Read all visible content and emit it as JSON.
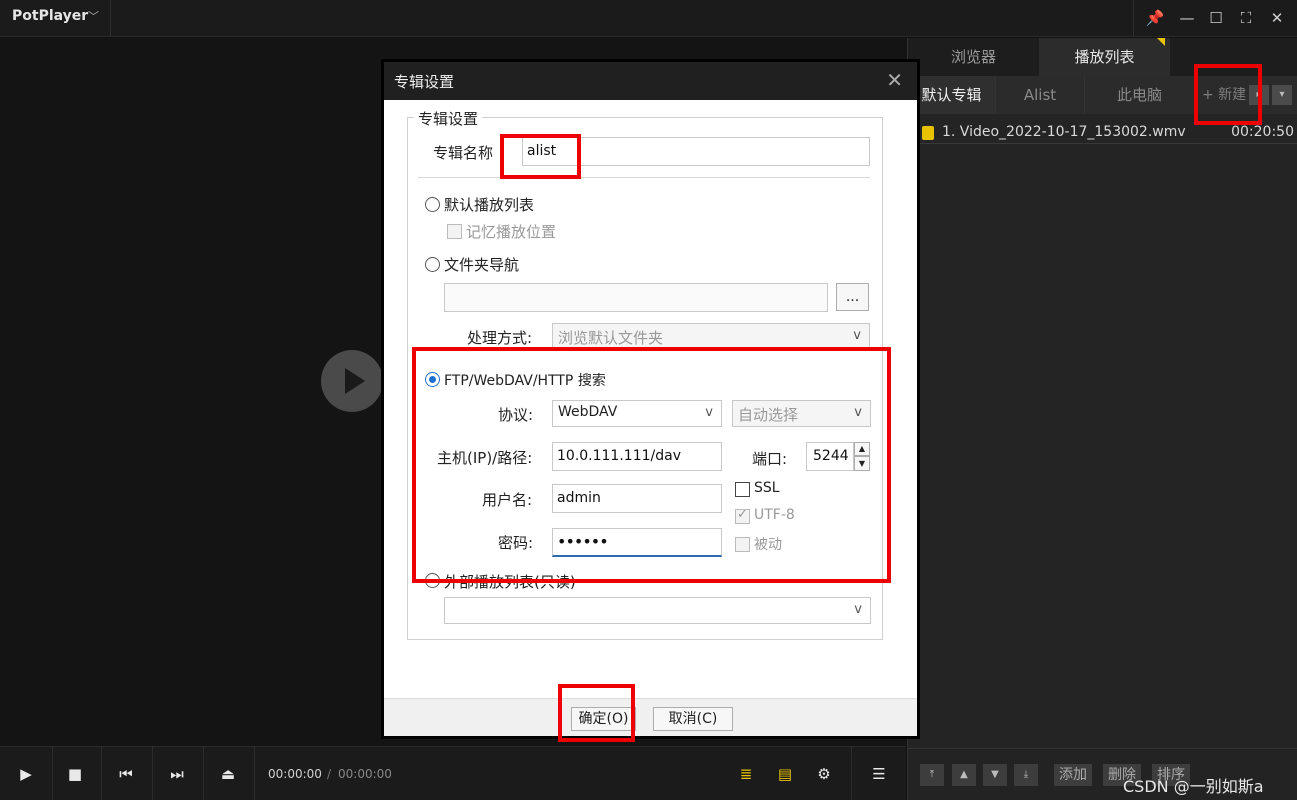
{
  "app": {
    "title": "PotPlayer",
    "title_chevron": "﹀"
  },
  "window_buttons": {
    "pin": "📌",
    "minimize": "—",
    "maximize": "☐",
    "fullscreen": "⛶",
    "close": "✕"
  },
  "controls": {
    "play": "▶",
    "stop": "■",
    "prev": "⏮",
    "next": "⏭",
    "eject": "⏏",
    "time_current": "00:00:00",
    "time_separator": "/",
    "time_total": "00:00:00",
    "playlist_search": "≣",
    "subtitle": "▤",
    "settings": "⚙",
    "menu": "☰"
  },
  "panel": {
    "tabs": [
      {
        "label": "浏览器"
      },
      {
        "label": "播放列表"
      }
    ],
    "album_tabs": [
      {
        "label": "默认专辑"
      },
      {
        "label": "Alist"
      },
      {
        "label": "此电脑"
      }
    ],
    "new_button": "+ 新建",
    "playlist": [
      {
        "name": "1. Video_2022-10-17_153002.wmv",
        "duration": "00:20:50"
      }
    ],
    "bottom": {
      "add": "添加",
      "delete": "删除",
      "sort": "排序"
    },
    "watermark": "CSDN @一别如斯a"
  },
  "dialog": {
    "title": "专辑设置",
    "close": "✕",
    "group_title": "专辑设置",
    "album_name_label": "专辑名称",
    "album_name_value": "alist",
    "option_default": "默认播放列表",
    "remember_position": "记忆播放位置",
    "option_folder": "文件夹导航",
    "browse_button": "...",
    "process_label": "处理方式:",
    "process_value": "浏览默认文件夹",
    "option_ftp": "FTP/WebDAV/HTTP 搜索",
    "protocol_label": "协议:",
    "protocol_value": "WebDAV",
    "encoding_value": "自动选择",
    "host_label": "主机(IP)/路径:",
    "host_value": "10.0.111.111/dav",
    "port_label": "端口:",
    "port_value": "5244",
    "ssl_label": "SSL",
    "username_label": "用户名:",
    "username_value": "admin",
    "utf8_label": "UTF-8",
    "password_label": "密码:",
    "password_value": "••••••",
    "passive_label": "被动",
    "option_external": "外部播放列表(只读)",
    "ok_button": "确定(O)",
    "cancel_button": "取消(C)",
    "chevron": "v"
  },
  "accent_colors": {
    "highlight_box": "#ee0000",
    "radio_selected": "#1e6fd0",
    "playlist_marker": "#e8c300"
  }
}
